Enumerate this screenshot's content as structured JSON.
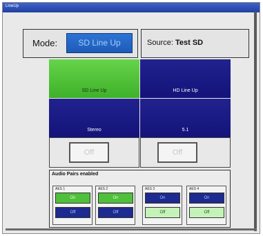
{
  "window": {
    "title": "LineUp"
  },
  "mode": {
    "label": "Mode:",
    "value": "SD Line Up"
  },
  "source": {
    "label": "Source:",
    "value": "Test SD"
  },
  "grid": {
    "sd_line_up": "SD Line Up",
    "hd_line_up": "HD Line Up",
    "stereo": "Stereo",
    "five_one": "5.1"
  },
  "off_buttons": {
    "left": "Off",
    "right": "Off"
  },
  "audio": {
    "title": "Audio Pairs enabled",
    "pairs": [
      {
        "label": "AES 1",
        "on": "On",
        "off": "Off",
        "state": "on"
      },
      {
        "label": "AES 2",
        "on": "On",
        "off": "Off",
        "state": "on"
      },
      {
        "label": "AES 3",
        "on": "On",
        "off": "Off",
        "state": "off"
      },
      {
        "label": "AES 4",
        "on": "On",
        "off": "Off",
        "state": "off"
      }
    ]
  },
  "colors": {
    "active_green": "#4ec03a",
    "navy": "#1d2a8f",
    "mode_blue": "#1e5bb8",
    "light_green": "#c4f2b9"
  }
}
